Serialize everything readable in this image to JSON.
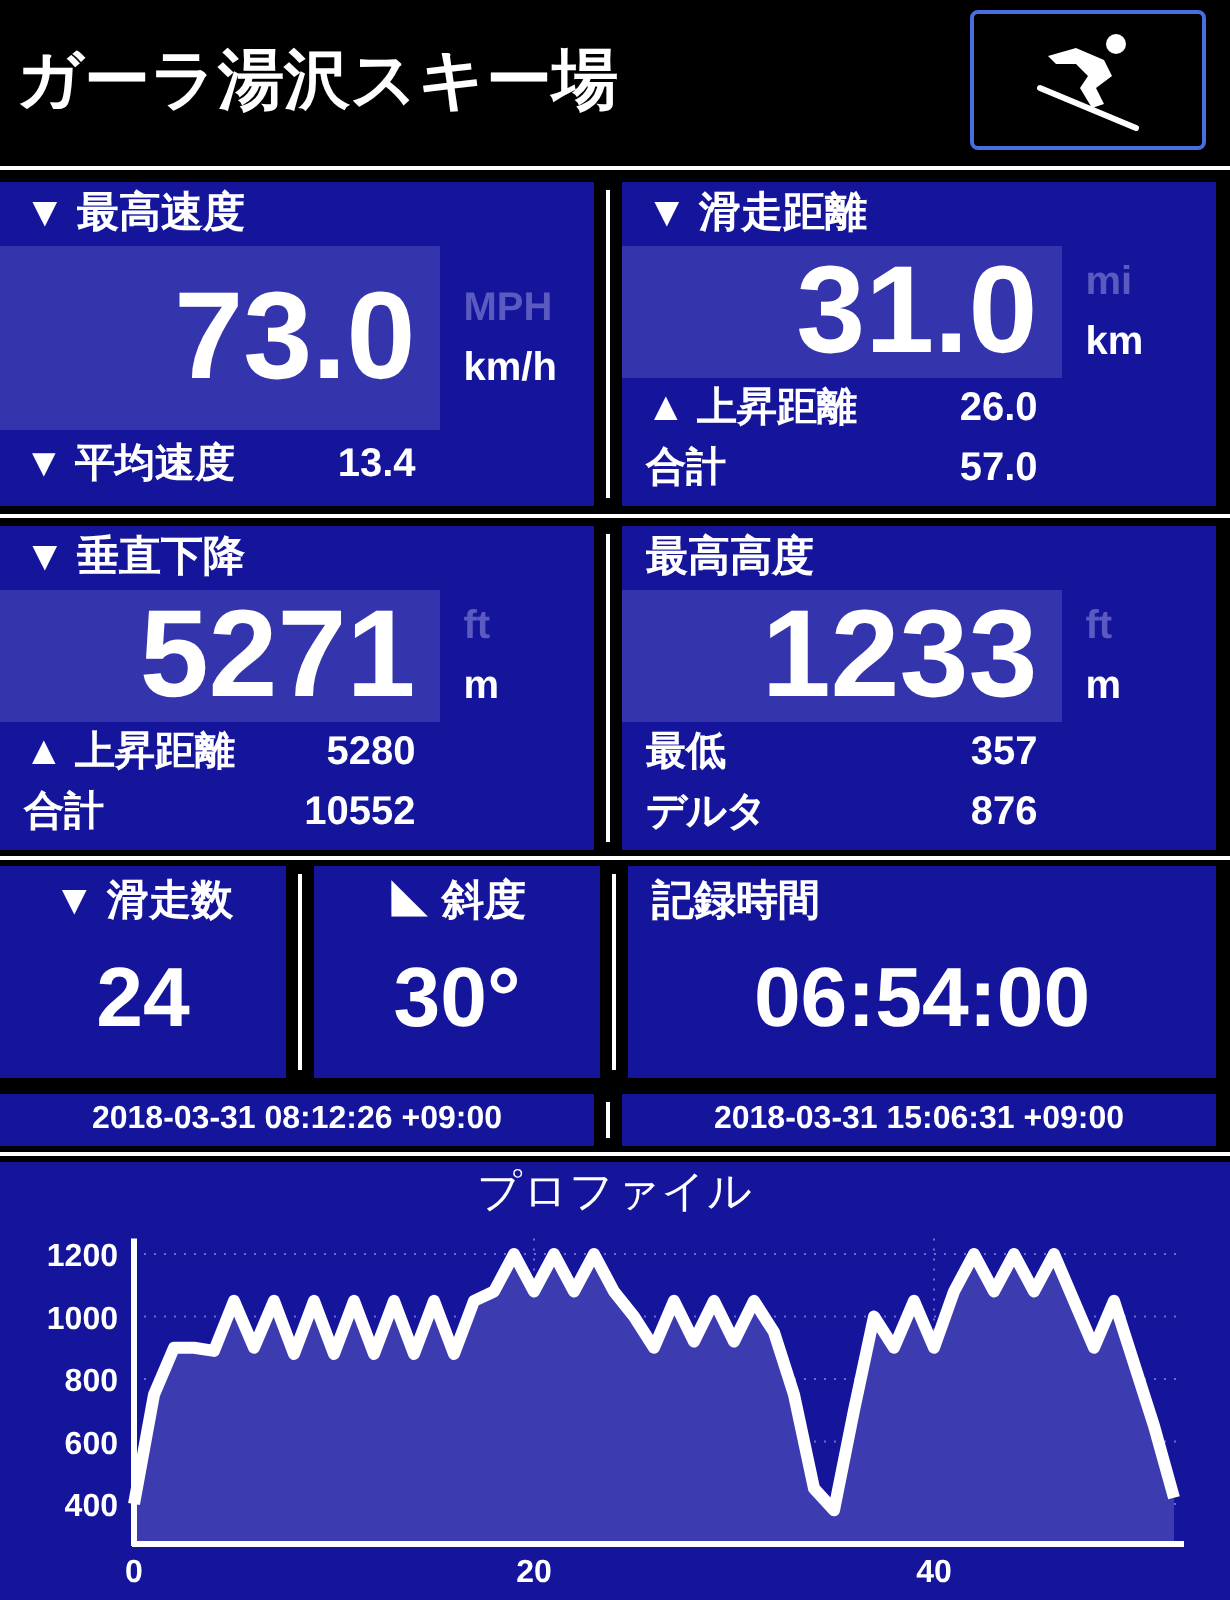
{
  "title": "ガーラ湯沢スキー場",
  "mode_button": {
    "selected": true
  },
  "panels": [
    {
      "label": "▼ 最高速度",
      "value": "73.0",
      "units": [
        {
          "label": "MPH",
          "selected": false
        },
        {
          "label": "km/h",
          "selected": true
        }
      ],
      "stats": [
        {
          "label": "▼ 平均速度",
          "value": "13.4"
        }
      ]
    },
    {
      "label": "▼ 滑走距離",
      "value": "31.0",
      "units": [
        {
          "label": "mi",
          "selected": false
        },
        {
          "label": "km",
          "selected": true
        }
      ],
      "stats": [
        {
          "label": "▲ 上昇距離",
          "value": "26.0"
        },
        {
          "label": "合計",
          "value": "57.0"
        }
      ]
    },
    {
      "label": "▼ 垂直下降",
      "value": "5271",
      "units": [
        {
          "label": "ft",
          "selected": false
        },
        {
          "label": "m",
          "selected": true
        }
      ],
      "stats": [
        {
          "label": "▲ 上昇距離",
          "value": "5280"
        },
        {
          "label": "合計",
          "value": "10552"
        }
      ]
    },
    {
      "label": "最高高度",
      "value": "1233",
      "units": [
        {
          "label": "ft",
          "selected": false
        },
        {
          "label": "m",
          "selected": true
        }
      ],
      "stats": [
        {
          "label": "最低",
          "value": "357"
        },
        {
          "label": "デルタ",
          "value": "876"
        }
      ]
    }
  ],
  "tiles": [
    {
      "label": "▼ 滑走数",
      "value": "24"
    },
    {
      "label": "◣ 斜度",
      "value": "30°"
    },
    {
      "label": "記録時間",
      "value": "06:54:00"
    }
  ],
  "timestamps": [
    "2018-03-31 08:12:26 +09:00",
    "2018-03-31 15:06:31 +09:00"
  ],
  "profile": {
    "chart_data": {
      "type": "area",
      "title": "プロファイル",
      "xlim": [
        0,
        52.5
      ],
      "ylim": [
        272,
        1250
      ],
      "xticks": [
        0,
        20,
        40
      ],
      "yticks": [
        400,
        600,
        800,
        1000,
        1200
      ],
      "x": [
        0,
        1,
        2,
        3,
        4,
        5,
        6,
        7,
        8,
        9,
        10,
        11,
        12,
        13,
        14,
        15,
        16,
        17,
        18,
        19,
        20,
        21,
        22,
        23,
        24,
        25,
        26,
        27,
        28,
        29,
        30,
        31,
        32,
        33,
        34,
        35,
        36,
        37,
        38,
        39,
        40,
        41,
        42,
        43,
        44,
        45,
        46,
        47,
        48,
        49,
        50,
        51,
        52
      ],
      "grid": true,
      "series": [
        {
          "color": "#ffffff",
          "values": [
            400,
            750,
            900,
            900,
            890,
            1050,
            900,
            1050,
            880,
            1050,
            880,
            1050,
            880,
            1050,
            880,
            1050,
            880,
            1050,
            1080,
            1200,
            1080,
            1200,
            1080,
            1200,
            1080,
            1000,
            900,
            1050,
            920,
            1050,
            920,
            1050,
            950,
            750,
            450,
            380,
            700,
            1000,
            900,
            1050,
            900,
            1080,
            1200,
            1080,
            1200,
            1080,
            1200,
            1050,
            900,
            1050,
            850,
            650,
            420
          ]
        }
      ]
    }
  }
}
